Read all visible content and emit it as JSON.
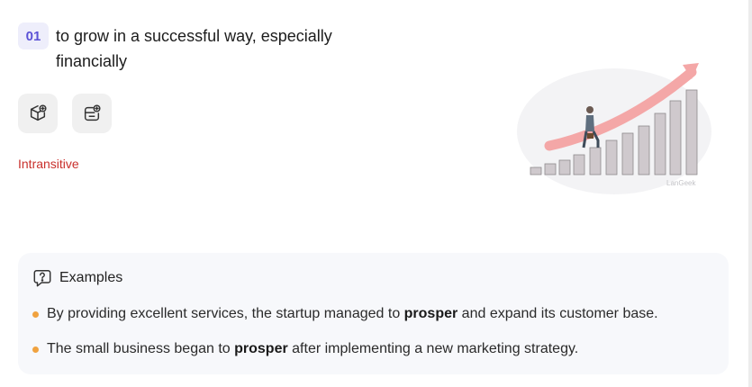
{
  "definition": {
    "number": "01",
    "text": "to grow in a successful way, especially financially"
  },
  "actions": {
    "icon_one": "cube-plus-icon",
    "icon_two": "card-plus-icon"
  },
  "grammar_tag": "Intransitive",
  "illustration": {
    "icon": "growth-chart-illustration",
    "watermark": "LanGeek"
  },
  "examples": {
    "heading": "Examples",
    "heading_icon": "question-bubble-icon",
    "items": [
      {
        "before": "By providing excellent services, the startup managed to ",
        "keyword": "prosper",
        "after": " and expand its customer base."
      },
      {
        "before": "The small business began to ",
        "keyword": "prosper",
        "after": " after implementing a new marketing strategy."
      }
    ]
  },
  "colors": {
    "badge_bg": "#eeeefb",
    "badge_text": "#5b52d6",
    "tag": "#c9302c",
    "bullet": "#f0a23f",
    "arrow": "#f2a3a3"
  }
}
